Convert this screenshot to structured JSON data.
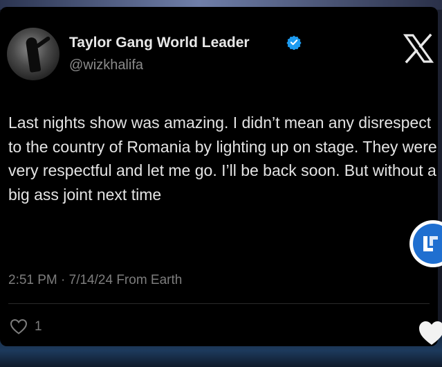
{
  "post": {
    "display_name": "Taylor Gang World Leader",
    "handle": "@wizkhalifa",
    "verified": true,
    "text": "Last nights show was amazing. I didn’t mean any disrespect to the country of Romania by lighting up on stage. They were very respectful and let me go. I’ll be back soon. But without a big ass joint next time",
    "meta": "2:51 PM · 7/14/24 From Earth",
    "like_count": "1"
  },
  "icons": {
    "verified": "verified-badge-icon",
    "platform": "x-logo-icon",
    "like": "heart-icon",
    "overlay_logo": "overlay-logo-icon",
    "overlay_heart": "heart-icon"
  },
  "colors": {
    "card_bg": "#000000",
    "verified_blue": "#1d9bf0",
    "text": "#e4e4e4",
    "muted": "#7d7d7d"
  }
}
